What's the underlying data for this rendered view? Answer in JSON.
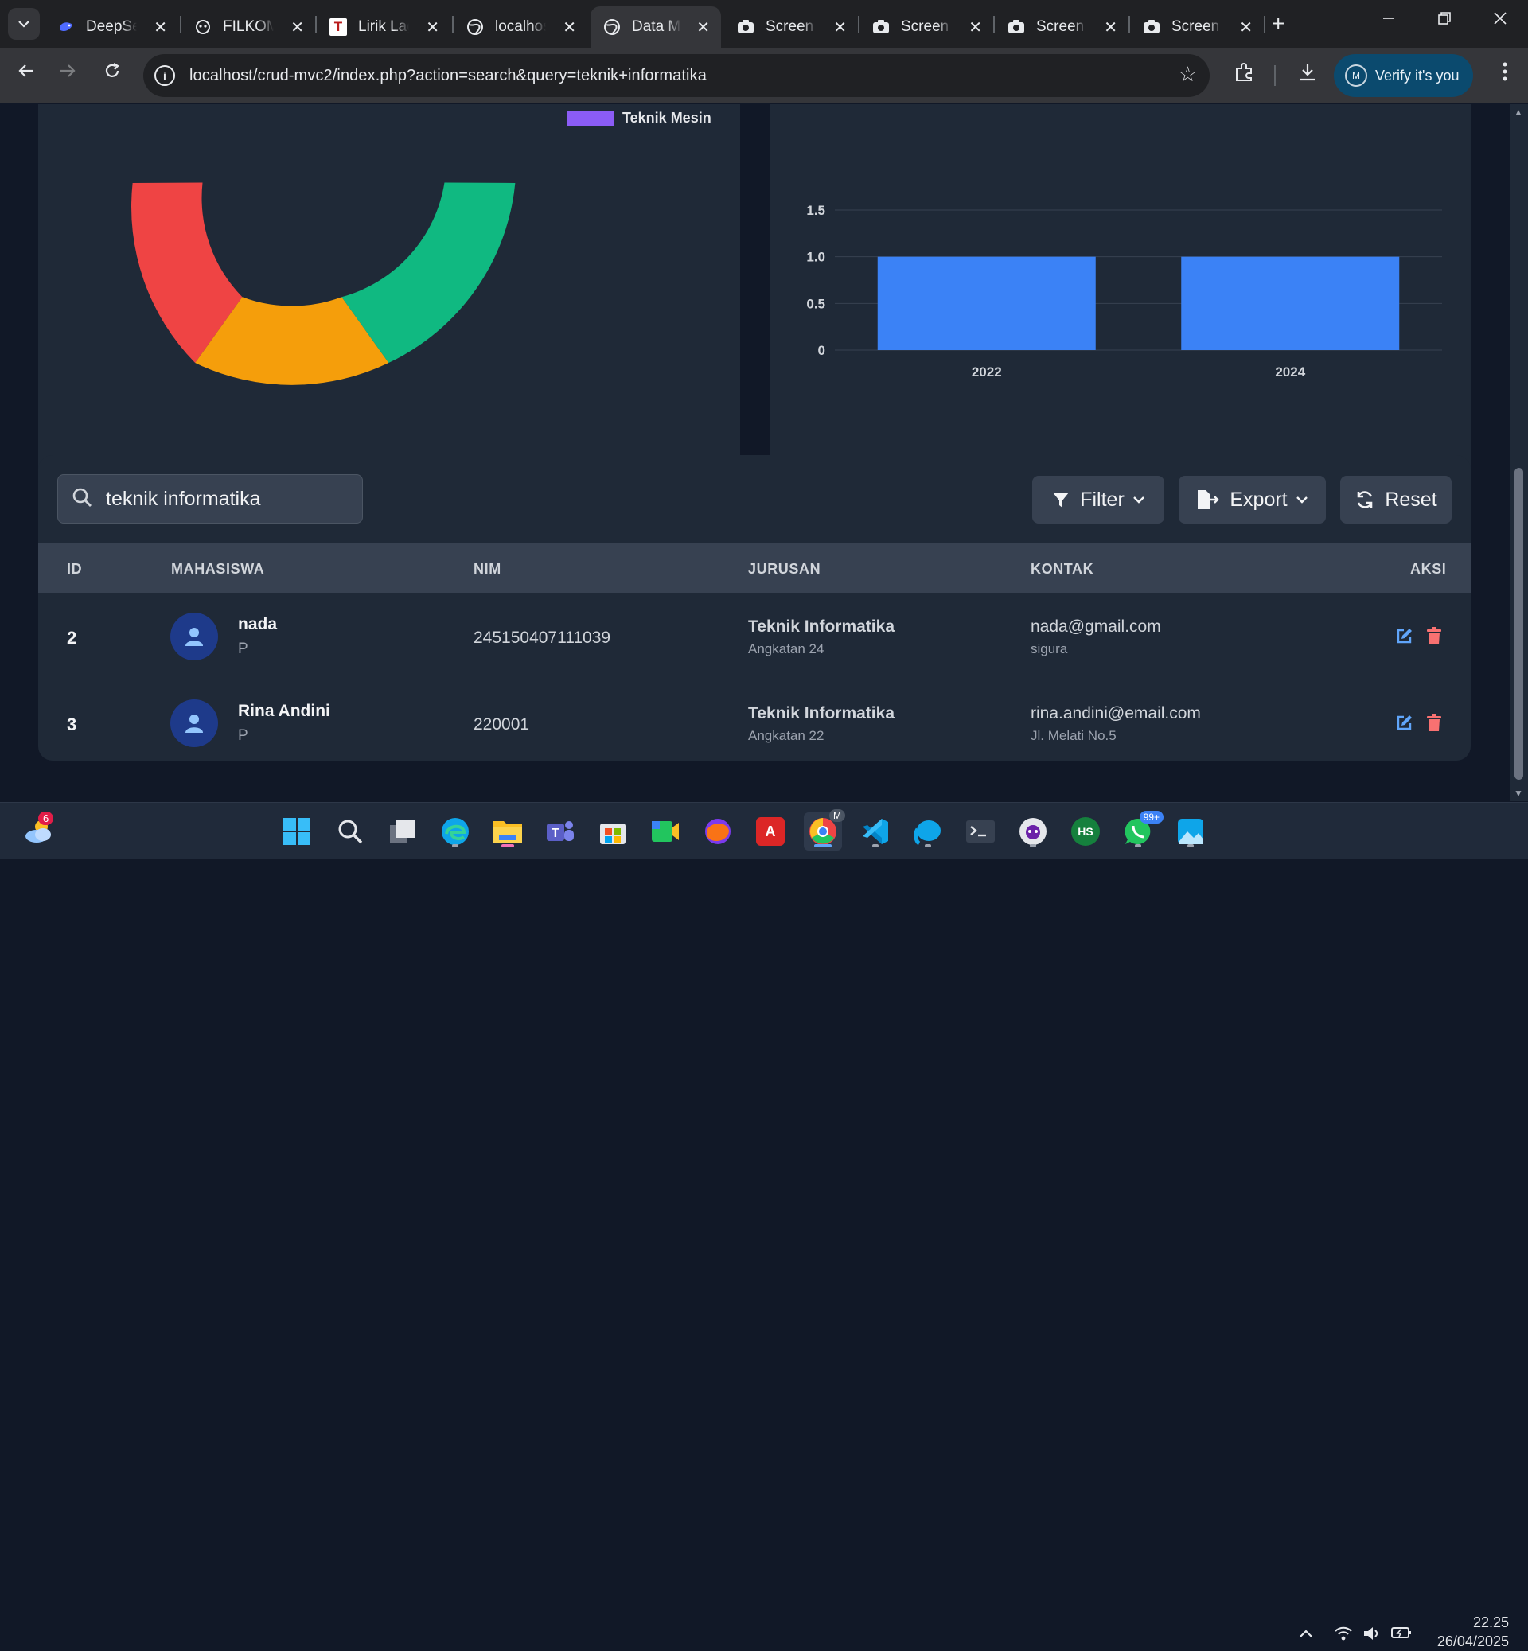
{
  "browser": {
    "tabs": [
      {
        "title": "DeepSeek",
        "icon": "deepseek-icon"
      },
      {
        "title": "FILKOM",
        "icon": "filkom-icon"
      },
      {
        "title": "Lirik Lagu",
        "icon": "t-logo-icon"
      },
      {
        "title": "localhost",
        "icon": "globe-icon"
      },
      {
        "title": "Data Mahasiswa",
        "icon": "globe-icon",
        "active": true
      },
      {
        "title": "Screen Capture",
        "icon": "camera-icon"
      },
      {
        "title": "Screen Capture",
        "icon": "camera-icon"
      },
      {
        "title": "Screen Capture",
        "icon": "camera-icon"
      },
      {
        "title": "Screen Capture",
        "icon": "camera-icon"
      }
    ],
    "url": "localhost/crud-mvc2/index.php?action=search&query=teknik+informatika",
    "profile_initial": "M",
    "verify_label": "Verify it's you"
  },
  "pie_legend": {
    "label": "Teknik Mesin",
    "color": "#8b5cf6"
  },
  "pie_colors": [
    "#ef4444",
    "#f59e0b",
    "#10b981"
  ],
  "chart_data": {
    "type": "bar",
    "categories": [
      "2022",
      "2024"
    ],
    "values": [
      1,
      1
    ],
    "yticks": [
      "1.5",
      "1.0",
      "0.5",
      "0"
    ],
    "ylim": [
      0,
      1.5
    ],
    "bar_color": "#3b82f6",
    "grid": true
  },
  "search": {
    "value": "teknik informatika"
  },
  "actions": {
    "filter": "Filter",
    "export": "Export",
    "reset": "Reset"
  },
  "table": {
    "headers": [
      "ID",
      "MAHASISWA",
      "NIM",
      "JURUSAN",
      "KONTAK",
      "AKSI"
    ],
    "rows": [
      {
        "id": "2",
        "name": "nada",
        "gender": "P",
        "nim": "245150407111039",
        "jurusan": "Teknik Informatika",
        "angkatan": "Angkatan 24",
        "email": "nada@gmail.com",
        "alamat": "sigura"
      },
      {
        "id": "3",
        "name": "Rina Andini",
        "gender": "P",
        "nim": "220001",
        "jurusan": "Teknik Informatika",
        "angkatan": "Angkatan 22",
        "email": "rina.andini@email.com",
        "alamat": "Jl. Melati No.5"
      }
    ]
  },
  "taskbar": {
    "weather_badge": "6",
    "whatsapp_badge": "99+",
    "chrome_badge": "M",
    "time": "22.25",
    "date": "26/04/2025"
  }
}
